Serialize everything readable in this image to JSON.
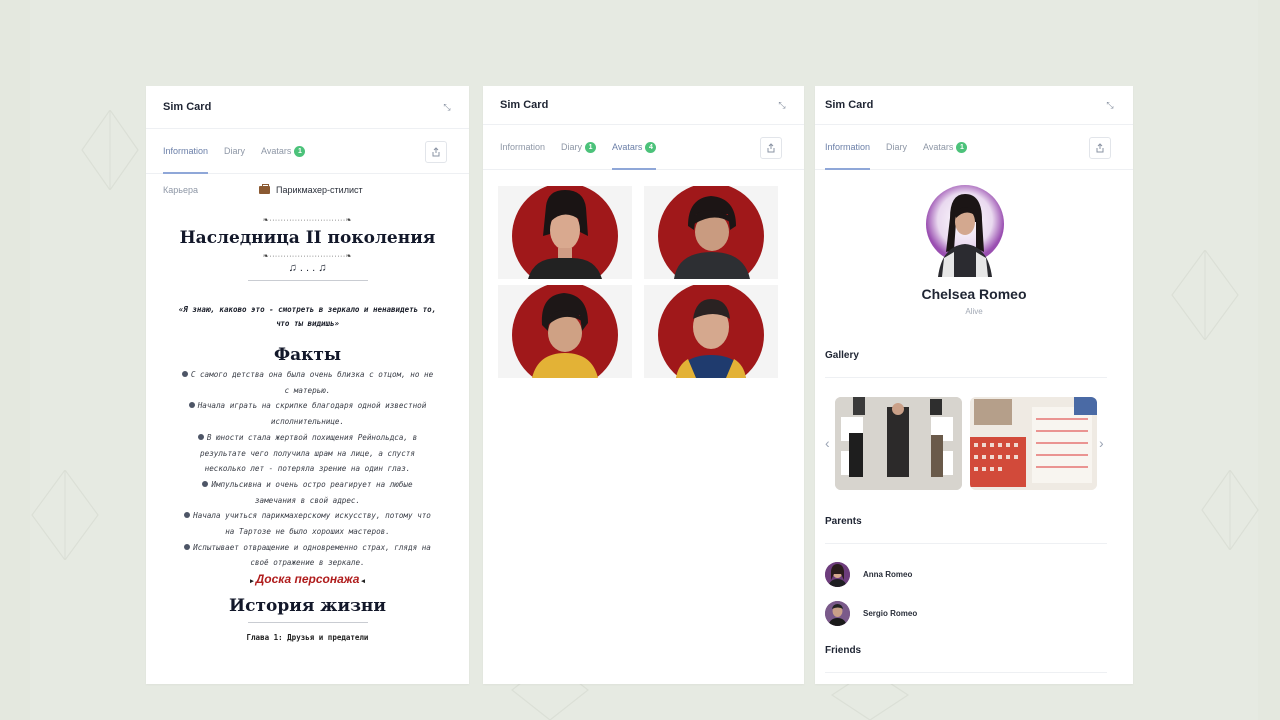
{
  "cards": [
    {
      "title": "Sim Card",
      "tabs": [
        {
          "label": "Information",
          "active": true
        },
        {
          "label": "Diary"
        },
        {
          "label": "Avatars",
          "badge": "1"
        }
      ],
      "career": {
        "label": "Карьера",
        "value": "Парикмахер-стилист"
      },
      "heir_title": "Наследница II поколения",
      "notes": "♫ . . . ♫",
      "dots_line": "❧···························❧",
      "quote": "«Я знаю, каково это - смотреть в зеркало и ненавидеть то, что ты видишь»",
      "facts_title": "Факты",
      "facts": [
        "С самого детства она была очень близка с отцом, но не с матерью.",
        "Начала играть на скрипке благодаря одной известной исполнительнице.",
        "В юности стала жертвой похищения Рейнольдса, в результате чего получила шрам на лице, а спустя несколько лет - потеряла зрение на один глаз.",
        "Импульсивна и очень остро реагирует на любые замечания в свой адрес.",
        "Начала учиться парикмахерскому искусству, потому что на Тартозе не было хороших мастеров.",
        "Испытывает отвращение и одновременно страх, глядя на своё отражение в зеркале."
      ],
      "board_link": "Доска персонажа",
      "history_title": "История жизни",
      "chapter": "Глава 1: Друзья и предатели"
    },
    {
      "title": "Sim Card",
      "tabs": [
        {
          "label": "Information"
        },
        {
          "label": "Diary",
          "badge": "1"
        },
        {
          "label": "Avatars",
          "badge": "4",
          "active": true
        }
      ]
    },
    {
      "title": "Sim Card",
      "tabs": [
        {
          "label": "Information",
          "active": true
        },
        {
          "label": "Diary"
        },
        {
          "label": "Avatars",
          "badge": "1"
        }
      ],
      "name": "Chelsea Romeo",
      "status": "Alive",
      "gallery_title": "Gallery",
      "parents_title": "Parents",
      "parents": [
        {
          "name": "Anna Romeo"
        },
        {
          "name": "Sergio Romeo"
        }
      ],
      "friends_title": "Friends"
    }
  ],
  "colors": {
    "accent_tab": "#8fa7d8",
    "badge": "#4cc27a",
    "avatar_bg": "#a0181a",
    "board_link": "#b01d1d"
  },
  "icons": [
    "expand-icon",
    "share-icon",
    "suitcase-icon",
    "chevron-left-icon",
    "chevron-right-icon"
  ]
}
